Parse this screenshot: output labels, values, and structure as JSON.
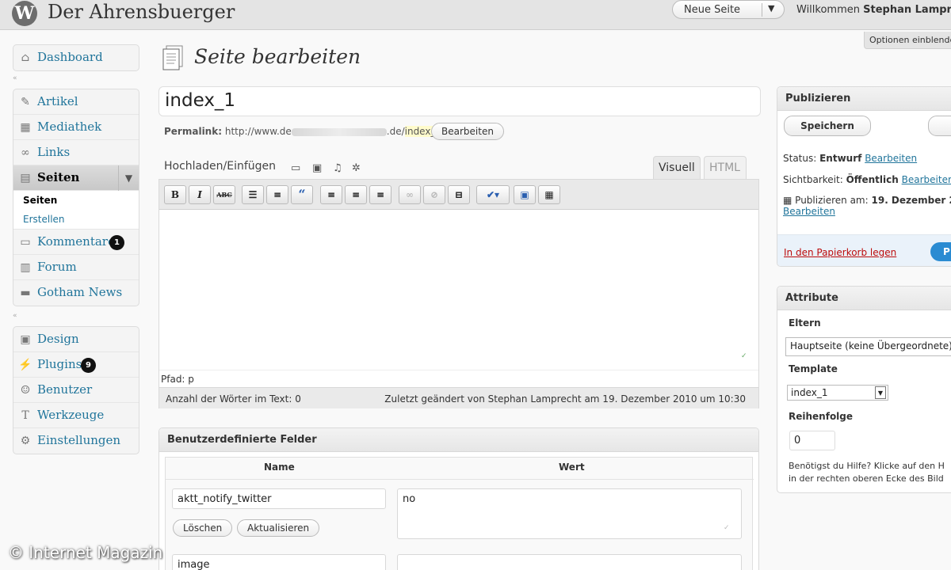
{
  "header": {
    "site_title": "Der Ahrensbuerger",
    "new_page_label": "Neue Seite",
    "welcome_prefix": "Willkommen",
    "user_name": "Stephan Lamprecht",
    "screen_options": "Optionen einblenden"
  },
  "sidebar": {
    "dashboard": "Dashboard",
    "artikel": "Artikel",
    "mediathek": "Mediathek",
    "links": "Links",
    "seiten": "Seiten",
    "sub_seiten": "Seiten",
    "sub_erstellen": "Erstellen",
    "kommentare": "Kommentare",
    "kommentare_count": "1",
    "forum": "Forum",
    "gotham_news": "Gotham News",
    "design": "Design",
    "plugins": "Plugins",
    "plugins_count": "9",
    "benutzer": "Benutzer",
    "werkzeuge": "Werkzeuge",
    "einstellungen": "Einstellungen"
  },
  "main": {
    "heading": "Seite bearbeiten",
    "title_value": "index_1",
    "permalink_label": "Permalink:",
    "permalink_prefix": "http://www.de",
    "permalink_domain_end": ".de/",
    "permalink_slug": "index_1",
    "permalink_suffix": "/",
    "permalink_edit": "Bearbeiten",
    "upload_label": "Hochladen/Einfügen",
    "tab_visual": "Visuell",
    "tab_html": "HTML",
    "path": "Pfad: p",
    "word_count": "Anzahl der Wörter im Text: 0",
    "last_edit": "Zuletzt geändert von Stephan Lamprecht am 19. Dezember 2010 um 10:30"
  },
  "custom_fields": {
    "title": "Benutzerdefinierte Felder",
    "col_name": "Name",
    "col_value": "Wert",
    "rows": [
      {
        "name": "aktt_notify_twitter",
        "value": "no",
        "delete": "Löschen",
        "update": "Aktualisieren"
      },
      {
        "name": "image",
        "value": ""
      }
    ]
  },
  "publish": {
    "title": "Publizieren",
    "save_button": "Speichern",
    "status_label": "Status:",
    "status_value": "Entwurf",
    "visibility_label": "Sichtbarkeit:",
    "visibility_value": "Öffentlich",
    "publish_label": "Publizieren am:",
    "publish_value": "19. Dezember 2",
    "edit_link": "Bearbeiten",
    "trash_link": "In den Papierkorb legen",
    "publish_button": "P"
  },
  "attributes": {
    "title": "Attribute",
    "parent_label": "Eltern",
    "parent_value": "Hauptseite (keine Übergeordnete)",
    "template_label": "Template",
    "template_value": "index_1",
    "order_label": "Reihenfolge",
    "order_value": "0",
    "help_line1": "Benötigst du Hilfe? Klicke auf den H",
    "help_line2": "in der rechten oberen Ecke des Bild"
  },
  "watermark": "© Internet Magazin",
  "colors": {
    "link": "#21759b",
    "trash": "#bc0b0b",
    "highlight": "#fffbcc"
  }
}
